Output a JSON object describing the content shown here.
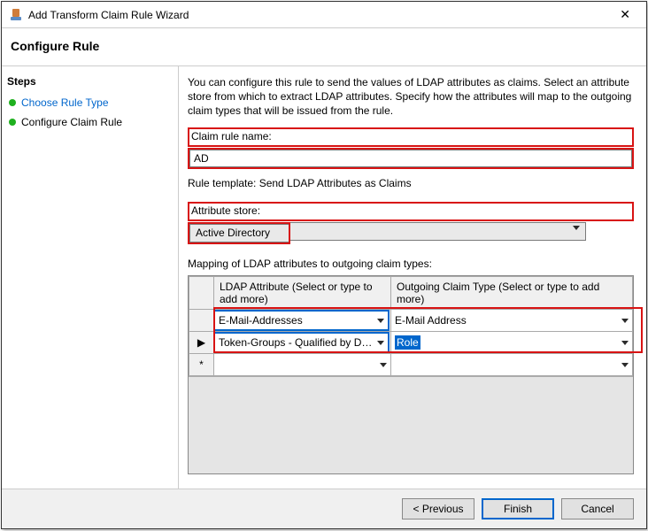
{
  "window_title": "Add Transform Claim Rule Wizard",
  "subtitle": "Configure Rule",
  "steps_heading": "Steps",
  "steps": [
    {
      "label": "Choose Rule Type",
      "kind": "link"
    },
    {
      "label": "Configure Claim Rule",
      "kind": "current"
    }
  ],
  "desc": "You can configure this rule to send the values of LDAP attributes as claims. Select an attribute store from which to extract LDAP attributes. Specify how the attributes will map to the outgoing claim types that will be issued from the rule.",
  "claim_rule_name_label": "Claim rule name:",
  "claim_rule_name_value": "AD",
  "rule_template_label": "Rule template: Send LDAP Attributes as Claims",
  "attribute_store_label": "Attribute store:",
  "attribute_store_value": "Active Directory",
  "mapping_label": "Mapping of LDAP attributes to outgoing claim types:",
  "grid": {
    "header_ldap": "LDAP Attribute (Select or type to add more)",
    "header_outgoing": "Outgoing Claim Type (Select or type to add more)",
    "rows": [
      {
        "ldap": "E-Mail-Addresses",
        "out": "E-Mail Address",
        "rowmark": ""
      },
      {
        "ldap": "Token-Groups - Qualified by Doma...",
        "out": "Role",
        "rowmark": "▶",
        "out_selected": true
      },
      {
        "ldap": "",
        "out": "",
        "rowmark": "*"
      }
    ]
  },
  "buttons": {
    "previous": "< Previous",
    "finish": "Finish",
    "cancel": "Cancel"
  }
}
